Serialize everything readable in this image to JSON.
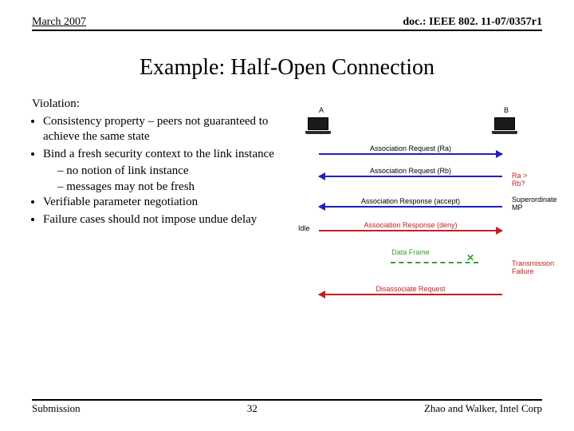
{
  "header": {
    "date": "March 2007",
    "doc_ref": "doc.: IEEE 802. 11-07/0357r1"
  },
  "title": "Example: Half-Open Connection",
  "violation": {
    "heading": "Violation:",
    "b1": "Consistency property – peers not guaranteed to achieve the same state",
    "b2": "Bind a fresh security context to the link instance",
    "b2a": "– no notion of link instance",
    "b2b": "– messages may not be fresh",
    "b3": "Verifiable parameter negotiation",
    "b4": "Failure cases should not impose undue delay"
  },
  "diagram": {
    "node_a": "A",
    "node_b": "B",
    "msg1": "Association Request (Ra)",
    "msg2": "Association Request (Rb)",
    "note_rarb": "Ra > Rb?",
    "msg3": "Association Response (accept)",
    "note_super": "Superordinate MP",
    "idle": "Idle",
    "msg4": "Association Response (deny)",
    "msg5": "Data Frame",
    "note_fail": "Transmission Failure",
    "msg6": "Disassociate Request"
  },
  "footer": {
    "left": "Submission",
    "page": "32",
    "right": "Zhao and Walker, Intel Corp"
  }
}
